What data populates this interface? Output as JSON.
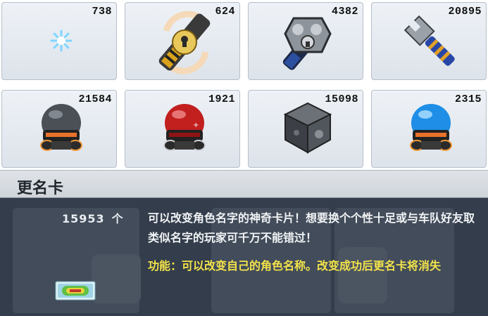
{
  "inventory": {
    "items": [
      {
        "name": "snowflake-item",
        "count": "738"
      },
      {
        "name": "lock-wrench-item",
        "count": "624"
      },
      {
        "name": "chrome-skull-wrench-item",
        "count": "4382"
      },
      {
        "name": "wrench-item",
        "count": "20895"
      },
      {
        "name": "black-helmet-item",
        "count": "21584"
      },
      {
        "name": "red-helmet-item",
        "count": "1921"
      },
      {
        "name": "metal-cube-item",
        "count": "15098"
      },
      {
        "name": "blue-helmet-item",
        "count": "2315"
      }
    ]
  },
  "detail": {
    "title": "更名卡",
    "quantity": "15953",
    "quantity_unit": "个",
    "description": "可以改变角色名字的神奇卡片！想要换个个性十足或与车队好友取类似名字的玩家可千万不能错过！",
    "function": "功能：可以改变自己的角色名称。改变成功后更名卡将消失",
    "card_icon": "rename-card-icon"
  },
  "colors": {
    "panel_bg": "#333d4b",
    "header_bg": "#dfe3e8",
    "description_text": "#f1f3f5",
    "function_text": "#f3e34a",
    "cell_bg": "#e6ebf1"
  }
}
